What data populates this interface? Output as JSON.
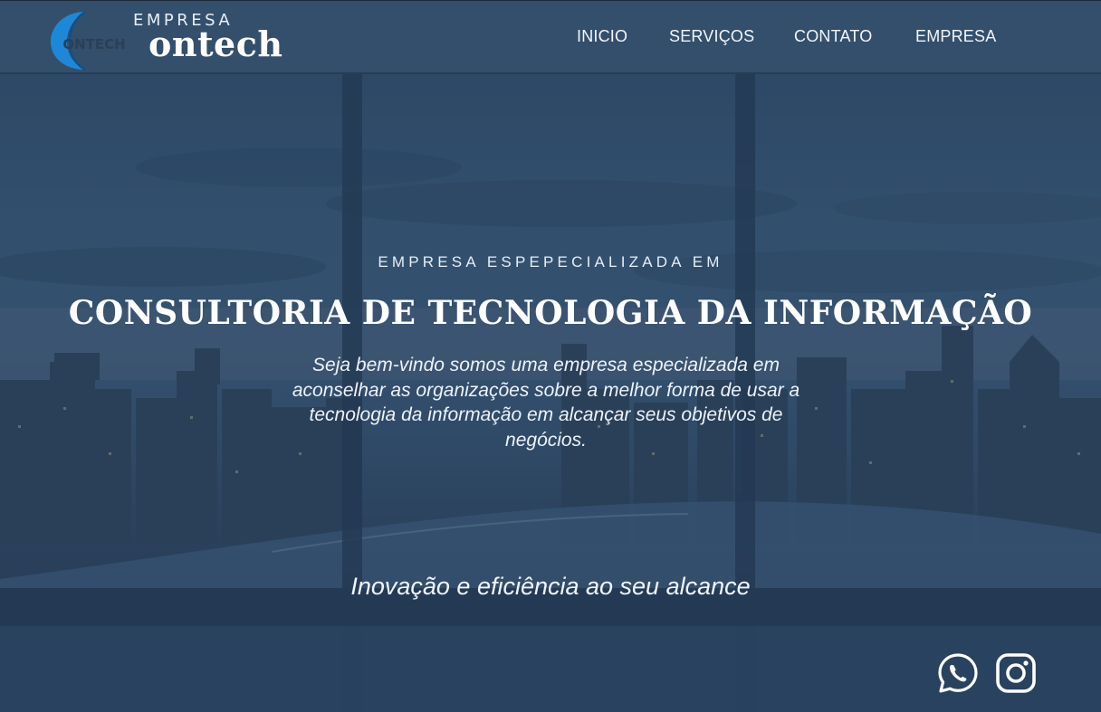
{
  "brand": {
    "small": "EMPRESA",
    "name": "ontech",
    "logo_text": "ONTECH",
    "accent": "#1e88d8"
  },
  "nav": {
    "items": [
      {
        "label": "INICIO"
      },
      {
        "label": "SERVIÇOS"
      },
      {
        "label": "CONTATO"
      },
      {
        "label": "EMPRESA"
      }
    ]
  },
  "hero": {
    "tagline": "EMPRESA ESPEPECIALIZADA EM",
    "headline": "CONSULTORIA DE TECNOLOGIA DA INFORMAÇÃO",
    "description": "Seja bem-vindo somos uma empresa especializada em aconselhar as organizações sobre a melhor forma de usar a tecnologia da informação em alcançar seus objetivos de negócios.",
    "motto": "Inovação e eficiência ao seu alcance"
  },
  "social": {
    "items": [
      {
        "icon": "whatsapp-icon"
      },
      {
        "icon": "instagram-icon"
      }
    ]
  },
  "colors": {
    "overlay": "#34506c",
    "text": "#ffffff"
  }
}
